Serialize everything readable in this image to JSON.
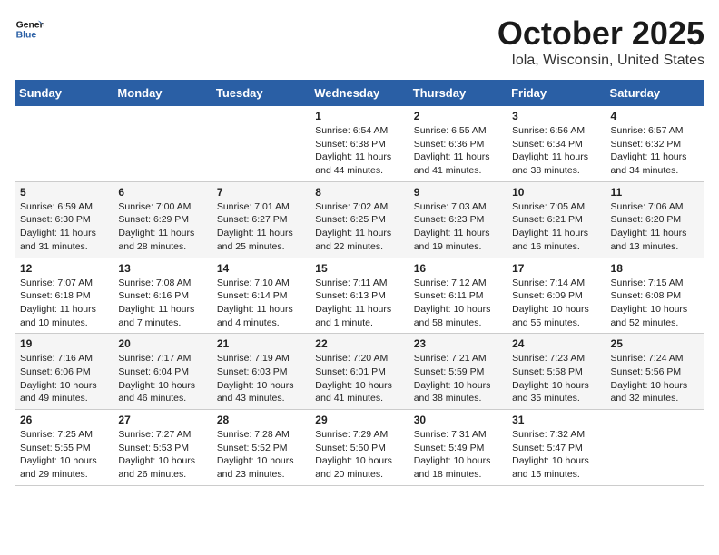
{
  "header": {
    "logo_line1": "General",
    "logo_line2": "Blue",
    "month": "October 2025",
    "location": "Iola, Wisconsin, United States"
  },
  "days_of_week": [
    "Sunday",
    "Monday",
    "Tuesday",
    "Wednesday",
    "Thursday",
    "Friday",
    "Saturday"
  ],
  "weeks": [
    [
      {
        "day": "",
        "info": ""
      },
      {
        "day": "",
        "info": ""
      },
      {
        "day": "",
        "info": ""
      },
      {
        "day": "1",
        "info": "Sunrise: 6:54 AM\nSunset: 6:38 PM\nDaylight: 11 hours\nand 44 minutes."
      },
      {
        "day": "2",
        "info": "Sunrise: 6:55 AM\nSunset: 6:36 PM\nDaylight: 11 hours\nand 41 minutes."
      },
      {
        "day": "3",
        "info": "Sunrise: 6:56 AM\nSunset: 6:34 PM\nDaylight: 11 hours\nand 38 minutes."
      },
      {
        "day": "4",
        "info": "Sunrise: 6:57 AM\nSunset: 6:32 PM\nDaylight: 11 hours\nand 34 minutes."
      }
    ],
    [
      {
        "day": "5",
        "info": "Sunrise: 6:59 AM\nSunset: 6:30 PM\nDaylight: 11 hours\nand 31 minutes."
      },
      {
        "day": "6",
        "info": "Sunrise: 7:00 AM\nSunset: 6:29 PM\nDaylight: 11 hours\nand 28 minutes."
      },
      {
        "day": "7",
        "info": "Sunrise: 7:01 AM\nSunset: 6:27 PM\nDaylight: 11 hours\nand 25 minutes."
      },
      {
        "day": "8",
        "info": "Sunrise: 7:02 AM\nSunset: 6:25 PM\nDaylight: 11 hours\nand 22 minutes."
      },
      {
        "day": "9",
        "info": "Sunrise: 7:03 AM\nSunset: 6:23 PM\nDaylight: 11 hours\nand 19 minutes."
      },
      {
        "day": "10",
        "info": "Sunrise: 7:05 AM\nSunset: 6:21 PM\nDaylight: 11 hours\nand 16 minutes."
      },
      {
        "day": "11",
        "info": "Sunrise: 7:06 AM\nSunset: 6:20 PM\nDaylight: 11 hours\nand 13 minutes."
      }
    ],
    [
      {
        "day": "12",
        "info": "Sunrise: 7:07 AM\nSunset: 6:18 PM\nDaylight: 11 hours\nand 10 minutes."
      },
      {
        "day": "13",
        "info": "Sunrise: 7:08 AM\nSunset: 6:16 PM\nDaylight: 11 hours\nand 7 minutes."
      },
      {
        "day": "14",
        "info": "Sunrise: 7:10 AM\nSunset: 6:14 PM\nDaylight: 11 hours\nand 4 minutes."
      },
      {
        "day": "15",
        "info": "Sunrise: 7:11 AM\nSunset: 6:13 PM\nDaylight: 11 hours\nand 1 minute."
      },
      {
        "day": "16",
        "info": "Sunrise: 7:12 AM\nSunset: 6:11 PM\nDaylight: 10 hours\nand 58 minutes."
      },
      {
        "day": "17",
        "info": "Sunrise: 7:14 AM\nSunset: 6:09 PM\nDaylight: 10 hours\nand 55 minutes."
      },
      {
        "day": "18",
        "info": "Sunrise: 7:15 AM\nSunset: 6:08 PM\nDaylight: 10 hours\nand 52 minutes."
      }
    ],
    [
      {
        "day": "19",
        "info": "Sunrise: 7:16 AM\nSunset: 6:06 PM\nDaylight: 10 hours\nand 49 minutes."
      },
      {
        "day": "20",
        "info": "Sunrise: 7:17 AM\nSunset: 6:04 PM\nDaylight: 10 hours\nand 46 minutes."
      },
      {
        "day": "21",
        "info": "Sunrise: 7:19 AM\nSunset: 6:03 PM\nDaylight: 10 hours\nand 43 minutes."
      },
      {
        "day": "22",
        "info": "Sunrise: 7:20 AM\nSunset: 6:01 PM\nDaylight: 10 hours\nand 41 minutes."
      },
      {
        "day": "23",
        "info": "Sunrise: 7:21 AM\nSunset: 5:59 PM\nDaylight: 10 hours\nand 38 minutes."
      },
      {
        "day": "24",
        "info": "Sunrise: 7:23 AM\nSunset: 5:58 PM\nDaylight: 10 hours\nand 35 minutes."
      },
      {
        "day": "25",
        "info": "Sunrise: 7:24 AM\nSunset: 5:56 PM\nDaylight: 10 hours\nand 32 minutes."
      }
    ],
    [
      {
        "day": "26",
        "info": "Sunrise: 7:25 AM\nSunset: 5:55 PM\nDaylight: 10 hours\nand 29 minutes."
      },
      {
        "day": "27",
        "info": "Sunrise: 7:27 AM\nSunset: 5:53 PM\nDaylight: 10 hours\nand 26 minutes."
      },
      {
        "day": "28",
        "info": "Sunrise: 7:28 AM\nSunset: 5:52 PM\nDaylight: 10 hours\nand 23 minutes."
      },
      {
        "day": "29",
        "info": "Sunrise: 7:29 AM\nSunset: 5:50 PM\nDaylight: 10 hours\nand 20 minutes."
      },
      {
        "day": "30",
        "info": "Sunrise: 7:31 AM\nSunset: 5:49 PM\nDaylight: 10 hours\nand 18 minutes."
      },
      {
        "day": "31",
        "info": "Sunrise: 7:32 AM\nSunset: 5:47 PM\nDaylight: 10 hours\nand 15 minutes."
      },
      {
        "day": "",
        "info": ""
      }
    ]
  ]
}
